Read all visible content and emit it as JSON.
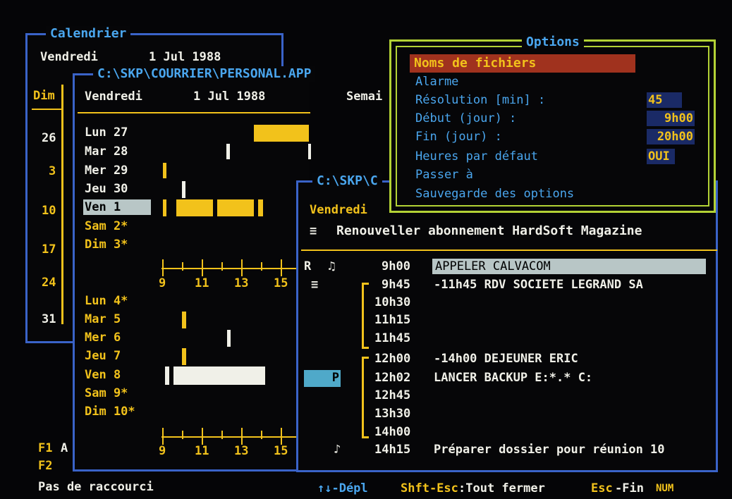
{
  "calendar": {
    "title": "Calendrier",
    "header_day": "Vendredi",
    "header_date": "1 Jul 1988",
    "col_header": "Dim",
    "sundays": [
      "26",
      "3",
      "10",
      "17",
      "24",
      "31"
    ]
  },
  "agenda": {
    "title": "C:\\SKP\\COURRIER\\PERSONAL.APP",
    "header_day": "Vendredi",
    "header_date": "1 Jul 1988",
    "header_week": "Semai",
    "week1": [
      "Lun 27",
      "Mar 28",
      "Mer 29",
      "Jeu 30",
      "Ven  1",
      "Sam  2*",
      "Dim  3*"
    ],
    "week2": [
      "Lun  4*",
      "Mar  5",
      "Mer  6",
      "Jeu  7",
      "Ven  8",
      "Sam  9*",
      "Dim 10*"
    ],
    "hours": [
      "9",
      "11",
      "13",
      "15"
    ]
  },
  "day": {
    "title": "C:\\SKP\\C",
    "day_name": "Vendredi",
    "note_icon": "≡",
    "note": "Renouveller abonnement HardSoft Magazine",
    "entries": [
      {
        "mark": "R",
        "icon": "♫",
        "time": "9h00",
        "text": "APPELER CALVACOM"
      },
      {
        "mark": "≡",
        "icon": "",
        "time": "9h45",
        "text": "-11h45  RDV SOCIETE LEGRAND SA"
      },
      {
        "mark": "",
        "icon": "",
        "time": "10h30",
        "text": ""
      },
      {
        "mark": "",
        "icon": "",
        "time": "11h15",
        "text": ""
      },
      {
        "mark": "",
        "icon": "",
        "time": "11h45",
        "text": ""
      },
      {
        "mark": "",
        "icon": "",
        "time": "12h00",
        "text": "-14h00  DEJEUNER ERIC"
      },
      {
        "mark": "P",
        "icon": "",
        "time": "12h02",
        "text": "LANCER BACKUP E:*.* C:"
      },
      {
        "mark": "",
        "icon": "",
        "time": "12h45",
        "text": ""
      },
      {
        "mark": "",
        "icon": "",
        "time": "13h30",
        "text": ""
      },
      {
        "mark": "",
        "icon": "",
        "time": "14h00",
        "text": ""
      },
      {
        "mark": "",
        "icon": "♪",
        "time": "14h15",
        "text": "Préparer dossier pour réunion 10"
      }
    ]
  },
  "options": {
    "title": "Options",
    "items": [
      "Noms de fichiers",
      "Alarme",
      "Résolution   [min] :",
      "Début (jour)       :",
      "Fin (jour)         :",
      "Heures par défaut",
      "Passer à",
      "Sauvegarde des options"
    ],
    "values": {
      "resolution": "45",
      "debut": "9h00",
      "fin": "20h00",
      "heures": "OUI"
    }
  },
  "fkeys": {
    "f1": "F1",
    "f1_text": "A",
    "f2": "F2"
  },
  "status": {
    "left": "Pas de raccourci",
    "nav": "↑↓-Dépl",
    "shift_key": "Shft-Esc",
    "shift_action": ":Tout fermer",
    "esc_key": "Esc",
    "esc_action": "-Fin",
    "num": "NUM"
  },
  "colors": {
    "frame": "#3a63c8",
    "options_frame": "#b3d235",
    "highlight": "#a0321e",
    "text": "#f0f0e8",
    "accent": "#f2c21b",
    "title": "#4aa6ee"
  }
}
